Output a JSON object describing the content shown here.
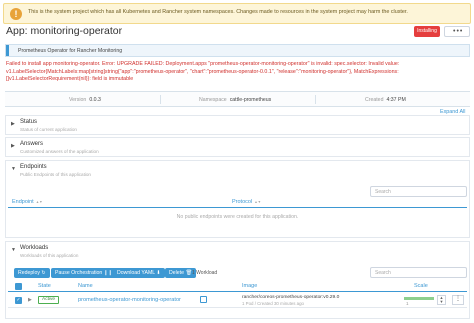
{
  "banner": {
    "icon": "warning-icon",
    "text": "This is the system project which has all Kubernetes and Rancher system namespaces. Changes made to resources in the system project may harm the cluster."
  },
  "header": {
    "title": "App: monitoring-operator",
    "status_label": "Installing",
    "more_label": "•••"
  },
  "info": {
    "text": "Prometheus Operator for Rancher Monitoring"
  },
  "error": {
    "text": "Failed to install app monitoring-operator. Error: UPGRADE FAILED: Deployment.apps \"prometheus-operator-monitoring-operator\" is invalid: spec.selector: Invalid value: v1.LabelSelector{MatchLabels:map[string]string{\"app\":\"prometheus-operator\", \"chart\":\"prometheus-operator-0.0.1\", \"release\":\"monitoring-operator\"}, MatchExpressions:[]v1.LabelSelectorRequirement(nil)}: field is immutable"
  },
  "meta": {
    "version_label": "Version",
    "version_value": "0.0.3",
    "namespace_label": "Namespace",
    "namespace_value": "cattle-prometheus",
    "created_label": "Created",
    "created_value": "4:37 PM"
  },
  "expand_all": "Expand All",
  "sections": {
    "status": {
      "title": "Status",
      "subtitle": "Status of current application"
    },
    "answers": {
      "title": "Answers",
      "subtitle": "Customized answers of the application"
    },
    "endpoints": {
      "title": "Endpoints",
      "subtitle": "Public Endpoints of this application"
    },
    "workloads": {
      "title": "Workloads",
      "subtitle": "Workloads of this application"
    }
  },
  "search_placeholder": "Search",
  "endpoints_table": {
    "columns": [
      "Endpoint",
      "Protocol"
    ],
    "empty_text": "No public endpoints were created for this application."
  },
  "workload_actions": {
    "redeploy": "Redeploy ↻",
    "pause": "Pause Orchestration ❙❙",
    "download": "Download YAML ⬇",
    "delete": "Delete 🗑",
    "count": "1 Workload"
  },
  "workloads_table": {
    "columns": [
      "State",
      "Name",
      "Image",
      "Scale"
    ],
    "rows": [
      {
        "state": "Active",
        "name": "prometheus-operator-monitoring-operator",
        "image": "rancher/coreos-prometheus-operator:v0.29.0",
        "image_sub": "1 Pod / Created 30 minutes ago",
        "scale": "1",
        "scale_fraction": 1.0
      }
    ]
  },
  "colors": {
    "accent": "#3d98d3",
    "error": "#d0302d",
    "status_installing": "#e53e3e",
    "active": "#4caf50"
  }
}
